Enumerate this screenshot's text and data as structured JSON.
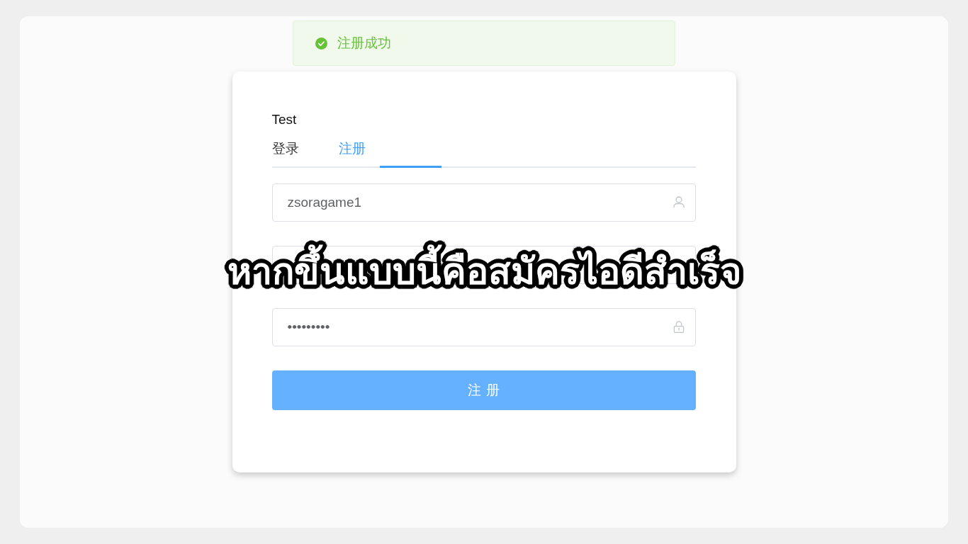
{
  "toast": {
    "kind": "success",
    "message": "注册成功"
  },
  "login_card": {
    "title": "Test",
    "tabs": [
      {
        "label": "登录",
        "selected": false
      },
      {
        "label": "注册",
        "selected": true
      }
    ],
    "fields": [
      {
        "kind": "user",
        "value": "zsoragame1"
      },
      {
        "kind": "covered"
      },
      {
        "kind": "password",
        "value": "•••••••••"
      }
    ],
    "submit_button": {
      "label": "注 册"
    }
  },
  "caption": {
    "text": "หากขึ้นแบบนี้คือสมัครไอดีสำเร็จ"
  }
}
